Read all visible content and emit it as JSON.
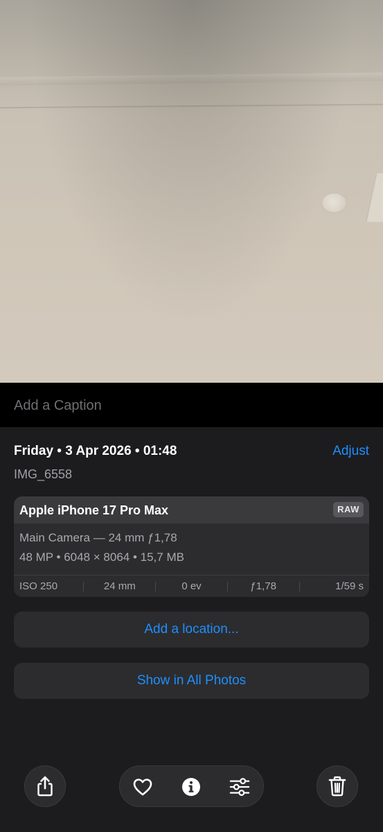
{
  "caption": {
    "placeholder": "Add a Caption",
    "value": ""
  },
  "info": {
    "date_line": "Friday • 3 Apr 2026 • 01:48",
    "adjust_label": "Adjust",
    "filename": "IMG_6558"
  },
  "camera_card": {
    "device": "Apple iPhone 17 Pro Max",
    "format_badge": "RAW",
    "lens_line": "Main Camera — 24 mm ƒ1,78",
    "specs_line": "48 MP • 6048 × 8064 • 15,7 MB",
    "exif": [
      "ISO 250",
      "24 mm",
      "0 ev",
      "ƒ1,78",
      "1/59 s"
    ]
  },
  "actions": {
    "add_location": "Add a location...",
    "show_all_photos": "Show in All Photos"
  },
  "toolbar": {
    "icons": [
      "share-icon",
      "heart-icon",
      "info-icon",
      "sliders-icon",
      "trash-icon"
    ]
  },
  "colors": {
    "accent": "#1e8fff",
    "background": "#1c1c1e",
    "card": "#2c2c2e",
    "caption_bar": "#000000"
  }
}
